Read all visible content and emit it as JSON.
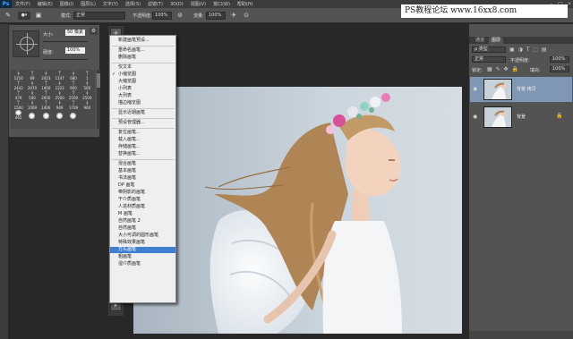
{
  "app": {
    "logo": "Ps"
  },
  "menubar": {
    "items": [
      "文件(F)",
      "编辑(E)",
      "图像(I)",
      "图层(L)",
      "文字(Y)",
      "选择(S)",
      "滤镜(T)",
      "3D(D)",
      "视图(V)",
      "窗口(W)",
      "帮助(H)"
    ],
    "window_controls": [
      "–",
      "□",
      "×"
    ]
  },
  "optionsbar": {
    "mode_label": "模式:",
    "mode_value": "正常",
    "opacity_label": "不透明度:",
    "opacity_value": "100%",
    "flow_label": "流量:",
    "flow_value": "100%"
  },
  "watermark": {
    "text": "PS教程论坛 www.16xx8.com"
  },
  "brush_panel": {
    "size_label": "大小:",
    "size_value": "50 像素",
    "hardness_label": "硬度:",
    "hardness_value": "100%",
    "gear_icon": "gear-icon",
    "preset_sizes": [
      "1216",
      "69",
      "2423",
      "1147",
      "680",
      "1",
      "2442",
      "2070",
      "1400",
      "1222",
      "900",
      "500",
      "479",
      "500",
      "2000",
      "2500",
      "2500",
      "2500",
      "1500",
      "1069",
      "1406",
      "949",
      "1709",
      "900",
      "465"
    ]
  },
  "context_menu": {
    "items": [
      {
        "label": "新建画笔预设...",
        "checked": false,
        "highlighted": false
      },
      {
        "sep": true
      },
      {
        "label": "重命名画笔...",
        "checked": false,
        "highlighted": false
      },
      {
        "label": "删除画笔",
        "checked": false,
        "highlighted": false
      },
      {
        "sep": true
      },
      {
        "label": "仅文本",
        "checked": false,
        "highlighted": false
      },
      {
        "label": "小缩览图",
        "checked": true,
        "highlighted": false
      },
      {
        "label": "大缩览图",
        "checked": false,
        "highlighted": false
      },
      {
        "label": "小列表",
        "checked": false,
        "highlighted": false
      },
      {
        "label": "大列表",
        "checked": false,
        "highlighted": false
      },
      {
        "label": "描边缩览图",
        "checked": false,
        "highlighted": false
      },
      {
        "sep": true
      },
      {
        "label": "显示近期画笔",
        "checked": false,
        "highlighted": false
      },
      {
        "sep": true
      },
      {
        "label": "预设管理器...",
        "checked": false,
        "highlighted": false
      },
      {
        "sep": true
      },
      {
        "label": "复位画笔...",
        "checked": false,
        "highlighted": false
      },
      {
        "label": "载入画笔...",
        "checked": false,
        "highlighted": false
      },
      {
        "label": "存储画笔...",
        "checked": false,
        "highlighted": false
      },
      {
        "label": "替换画笔...",
        "checked": false,
        "highlighted": false
      },
      {
        "sep": true
      },
      {
        "label": "混合画笔",
        "checked": false,
        "highlighted": false
      },
      {
        "label": "基本画笔",
        "checked": false,
        "highlighted": false
      },
      {
        "label": "书法画笔",
        "checked": false,
        "highlighted": false
      },
      {
        "label": "DP 画笔",
        "checked": false,
        "highlighted": false
      },
      {
        "label": "带阴影的画笔",
        "checked": false,
        "highlighted": false
      },
      {
        "label": "干介质画笔",
        "checked": false,
        "highlighted": false
      },
      {
        "label": "人造材质画笔",
        "checked": false,
        "highlighted": false
      },
      {
        "label": "M 画笔",
        "checked": false,
        "highlighted": false
      },
      {
        "label": "自然画笔 2",
        "checked": false,
        "highlighted": false
      },
      {
        "label": "自然画笔",
        "checked": false,
        "highlighted": false
      },
      {
        "label": "大小可调的圆形画笔",
        "checked": false,
        "highlighted": false
      },
      {
        "label": "特殊效果画笔",
        "checked": false,
        "highlighted": false
      },
      {
        "label": "方头画笔",
        "checked": false,
        "highlighted": true
      },
      {
        "label": "粗画笔",
        "checked": false,
        "highlighted": false
      },
      {
        "label": "湿介质画笔",
        "checked": false,
        "highlighted": false
      }
    ]
  },
  "layers_panel": {
    "tabs": [
      "通道",
      "图层"
    ],
    "active_tab": 1,
    "kind_value": "ρ 类型",
    "blend_value": "正常",
    "opacity_label": "不透明度:",
    "opacity_value": "100%",
    "lock_label": "锁定:",
    "fill_label": "填充:",
    "fill_value": "100%",
    "layers": [
      {
        "name": "背景 拷贝",
        "active": true,
        "locked": false
      },
      {
        "name": "背景",
        "active": false,
        "locked": true
      }
    ]
  }
}
